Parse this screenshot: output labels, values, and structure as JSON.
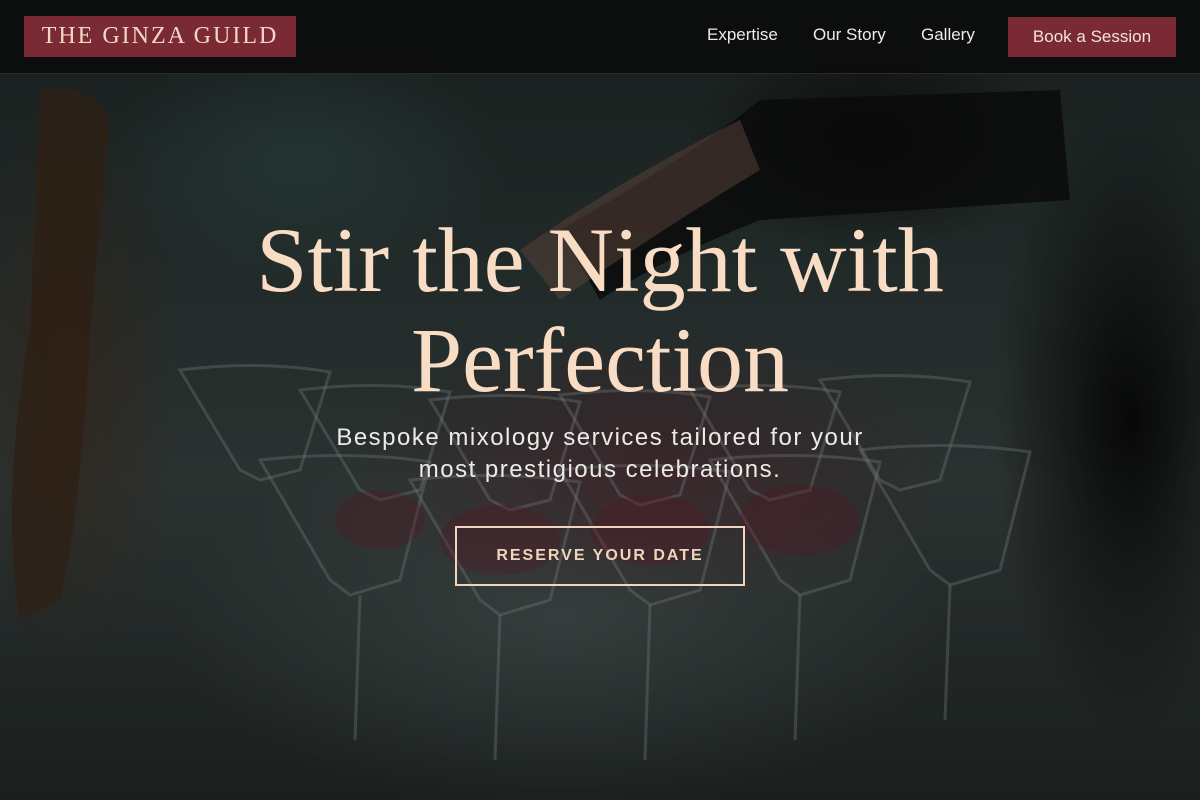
{
  "header": {
    "logo_text": "THE GINZA GUILD",
    "nav": [
      {
        "label": "Expertise"
      },
      {
        "label": "Our Story"
      },
      {
        "label": "Gallery"
      }
    ],
    "cta_label": "Book a Session"
  },
  "hero": {
    "title_line1": "Stir the Night with",
    "title_line2": "Perfection",
    "subtitle_line1": "Bespoke mixology services tailored for your",
    "subtitle_line2": "most prestigious celebrations.",
    "button_label": "RESERVE YOUR DATE",
    "background_image": "cocktail-glasses-bartender-photo"
  },
  "colors": {
    "brand": "#7a2a35",
    "accent_text": "#f8dcc4",
    "nav_bg": "#0c0c0c"
  }
}
